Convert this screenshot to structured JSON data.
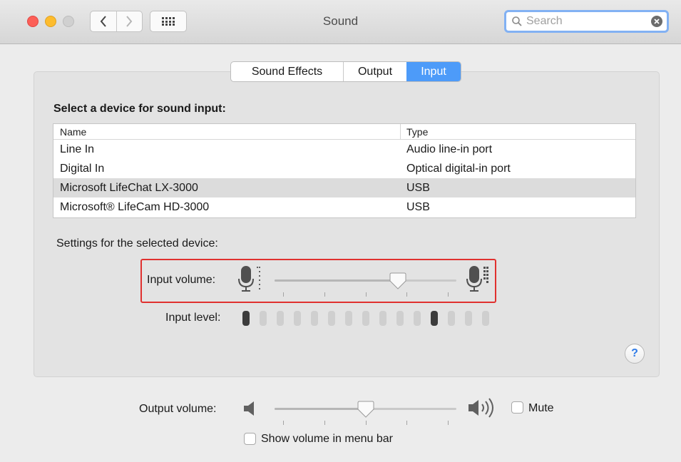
{
  "window": {
    "title": "Sound",
    "search_placeholder": "Search"
  },
  "tabs": [
    {
      "label": "Sound Effects",
      "selected": false
    },
    {
      "label": "Output",
      "selected": false
    },
    {
      "label": "Input",
      "selected": true
    }
  ],
  "input": {
    "section_title": "Select a device for sound input:",
    "columns": [
      "Name",
      "Type"
    ],
    "devices": [
      {
        "name": "Line In",
        "type": "Audio line-in port",
        "selected": false
      },
      {
        "name": "Digital In",
        "type": "Optical digital-in port",
        "selected": false
      },
      {
        "name": "Microsoft LifeChat LX-3000",
        "type": "USB",
        "selected": true
      },
      {
        "name": "Microsoft® LifeCam HD-3000",
        "type": "USB",
        "selected": false
      }
    ],
    "settings_title": "Settings for the selected device:",
    "volume_label": "Input volume:",
    "volume_level": 0.68,
    "level_label": "Input level:",
    "level_segments": 15,
    "level_active_segments": [
      1,
      12
    ]
  },
  "output": {
    "volume_label": "Output volume:",
    "volume_level": 0.5,
    "mute_label": "Mute",
    "mute_checked": false,
    "show_in_menubar_label": "Show volume in menu bar",
    "show_in_menubar_checked": false
  },
  "help_label": "?",
  "colors": {
    "accent": "#4d9bf9",
    "highlight_border": "#e0312f",
    "close": "#fc5f57",
    "minimize": "#fdbc2e"
  }
}
